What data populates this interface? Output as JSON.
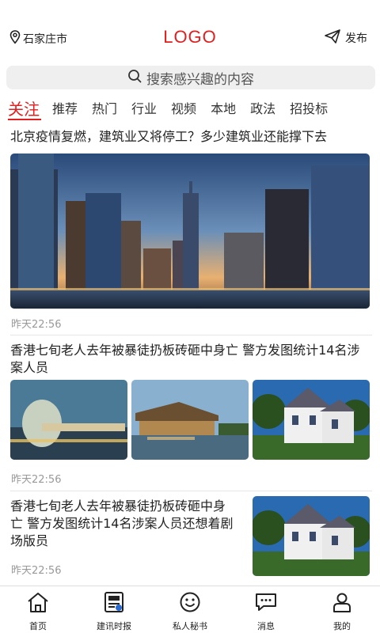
{
  "header": {
    "location": "石家庄市",
    "logo": "LOGO",
    "publish_label": "发布",
    "icons": {
      "location": "map-pin-icon",
      "publish": "paper-plane-icon"
    },
    "logo_color": "#e02020"
  },
  "search": {
    "placeholder": "搜索感兴趣的内容",
    "icon": "search-icon"
  },
  "tabs": [
    {
      "label": "关注",
      "active": true
    },
    {
      "label": "推荐"
    },
    {
      "label": "热门"
    },
    {
      "label": "行业"
    },
    {
      "label": "视频"
    },
    {
      "label": "本地"
    },
    {
      "label": "政法"
    },
    {
      "label": "招投标"
    }
  ],
  "news": [
    {
      "title": "北京疫情复燃，建筑业又将停工？多少建筑业还能撑下去",
      "time": "昨天22:56",
      "image": "city-skyline-photo"
    },
    {
      "title": "香港七旬老人去年被暴徒扔板砖砸中身亡  警方发图统计14名涉案人员",
      "time": "昨天22:56",
      "images": [
        "modern-building-photo",
        "waterfront-pavilion-photo",
        "victorian-house-photo"
      ]
    },
    {
      "title": "香港七旬老人去年被暴徒扔板砖砸中身亡  警方发图统计14名涉案人员还想着剧场版员",
      "time": "昨天22:56",
      "image": "victorian-house-photo"
    }
  ],
  "bottom_nav": [
    {
      "label": "首页",
      "icon": "home-icon"
    },
    {
      "label": "建讯时报",
      "icon": "newspaper-icon"
    },
    {
      "label": "私人秘书",
      "icon": "smiley-icon"
    },
    {
      "label": "消息",
      "icon": "chat-icon"
    },
    {
      "label": "我的",
      "icon": "user-icon"
    }
  ],
  "colors": {
    "accent": "#e02020",
    "muted": "#999999"
  }
}
